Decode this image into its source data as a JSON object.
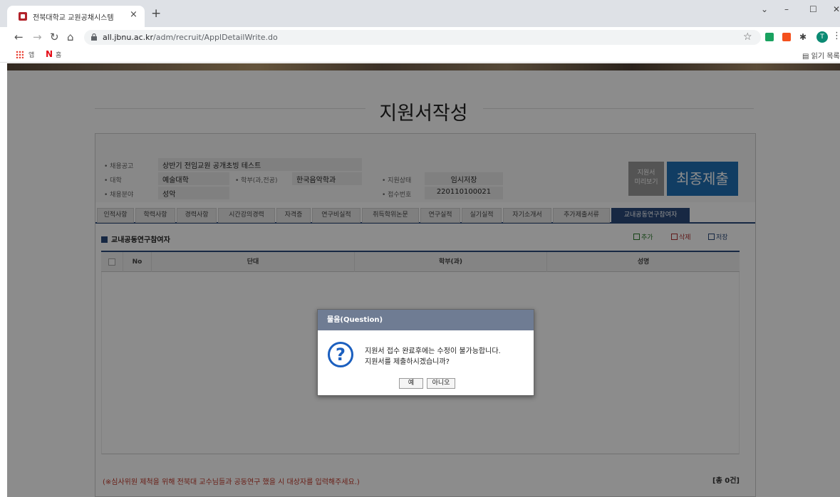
{
  "browser": {
    "tab_title": "전북대학교 교원공채시스템",
    "tab_close": "×",
    "new_tab": "+",
    "url_host": "all.jbnu.ac.kr",
    "url_path": "/adm/recruit/ApplDetailWrite.do",
    "avatar_letter": "T",
    "bookmarks": [
      "앱",
      "홈"
    ],
    "reading_list": "읽기 목록"
  },
  "page": {
    "title": "지원서작성"
  },
  "info": {
    "labels": {
      "notice": "• 채용공고",
      "college": "• 대학",
      "dept": "• 학부(과,전공)",
      "field": "• 채용분야",
      "status": "• 지원상태",
      "receipt": "• 접수번호"
    },
    "values": {
      "notice": "상반기 전임교원 공개초빙 테스트",
      "college": "예술대학",
      "dept": "한국음악학과",
      "field": "성악",
      "status": "임시저장",
      "receipt": "220110100021"
    },
    "btn_resume": "지원서\n미리보기",
    "btn_submit": "최종제출"
  },
  "tabs": [
    "인적사항",
    "학력사항",
    "경력사항",
    "시간강의경력",
    "자격증",
    "연구비실적",
    "취득학위논문",
    "연구실적",
    "실기실적",
    "자기소개서",
    "추가제출서류",
    "교내공동연구참여자"
  ],
  "active_tab": "교내공동연구참여자",
  "section": {
    "title": "교내공동연구참여자",
    "add": "추가",
    "delete": "삭제",
    "save": "저장",
    "columns": [
      "No",
      "단대",
      "학부(과)",
      "성명"
    ],
    "notice": "(※심사위원 제척을 위해 전북대 교수님들과 공동연구 했을 시 대상자를 입력해주세요.)",
    "count": "[총 0건]"
  },
  "dialog": {
    "title": "물음(Question)",
    "icon": "?",
    "line1": "지원서 접수 완료후에는 수정이 불가능합니다.",
    "line2": "지원서를 제출하시겠습니까?",
    "yes": "예",
    "no": "아니오"
  },
  "colors": {
    "accent": "#2a4a7a",
    "submit": "#1f6fb5",
    "dialog_header": "#6f7c93",
    "notice_text": "#c0392b"
  }
}
